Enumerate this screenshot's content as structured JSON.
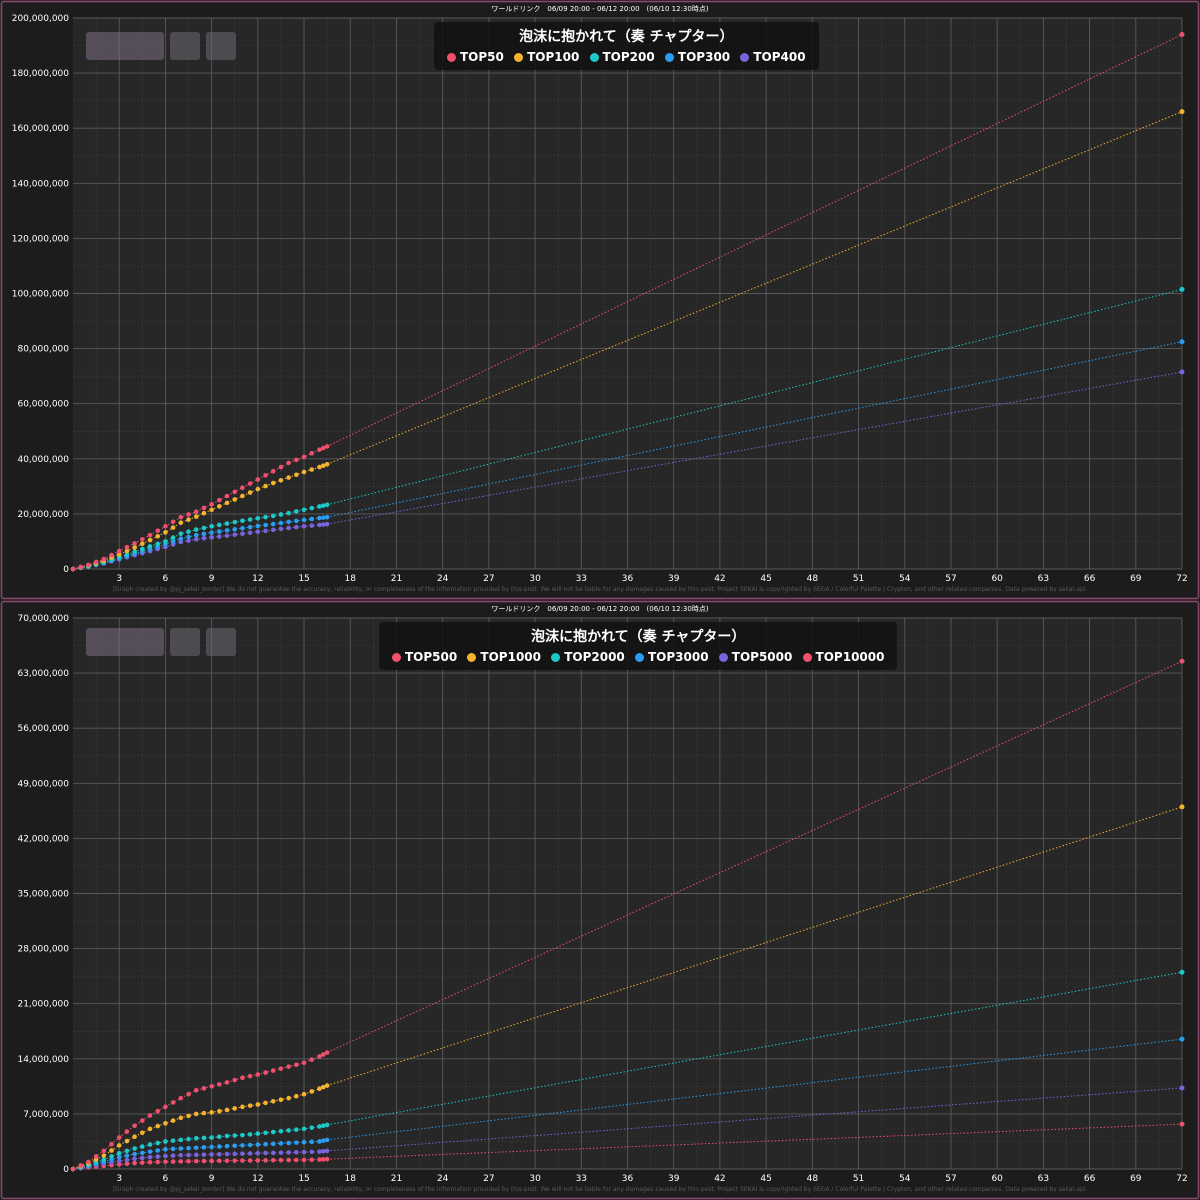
{
  "chart_data": [
    {
      "type": "line",
      "header": "ワールドリンク　06/09 20:00 - 06/12 20:00　(06/10 12:30時点)",
      "title": "泡沫に抱かれて（奏 チャプター）",
      "xlim": [
        0,
        72
      ],
      "x_ticks": [
        3,
        6,
        9,
        12,
        15,
        18,
        21,
        24,
        27,
        30,
        33,
        36,
        39,
        42,
        45,
        48,
        51,
        54,
        57,
        60,
        63,
        66,
        69,
        72
      ],
      "ylim": [
        0,
        200000000
      ],
      "y_ticks": [
        "0",
        "20,000,000",
        "40,000,000",
        "60,000,000",
        "80,000,000",
        "100,000,000",
        "120,000,000",
        "140,000,000",
        "160,000,000",
        "180,000,000",
        "200,000,000"
      ],
      "grid": true,
      "legend": "top-center",
      "credit": "[Graph created by @pj_sekai_border]  We do not guarantee the accuracy, reliability, or completeness of the information provided by this post. We will not be liable for any damages caused by this post. Project SEKAI is copyrighted by SEGA / Colorful Palette / Crypton, and other related companies. Data powered by sekai-api.",
      "series": [
        {
          "name": "TOP50",
          "color": "#f0506e",
          "points": [
            [
              0,
              0
            ],
            [
              1,
              1500000
            ],
            [
              2,
              3600000
            ],
            [
              3,
              6500000
            ],
            [
              4,
              9300000
            ],
            [
              5,
              12300000
            ],
            [
              6,
              15500000
            ],
            [
              7,
              18800000
            ],
            [
              8,
              20800000
            ],
            [
              9,
              23500000
            ],
            [
              10,
              26500000
            ],
            [
              11,
              29500000
            ],
            [
              12,
              32500000
            ],
            [
              13,
              35500000
            ],
            [
              14,
              38500000
            ],
            [
              15,
              40700000
            ],
            [
              16,
              43300000
            ],
            [
              16.5,
              44500000
            ]
          ],
          "projection": [
            72,
            194000000
          ]
        },
        {
          "name": "TOP100",
          "color": "#f5b32f",
          "points": [
            [
              0,
              0
            ],
            [
              1,
              1300000
            ],
            [
              2,
              3000000
            ],
            [
              3,
              5300000
            ],
            [
              4,
              7800000
            ],
            [
              5,
              10500000
            ],
            [
              6,
              13300000
            ],
            [
              7,
              16800000
            ],
            [
              8,
              19000000
            ],
            [
              9,
              21500000
            ],
            [
              10,
              24000000
            ],
            [
              11,
              26500000
            ],
            [
              12,
              29000000
            ],
            [
              13,
              31200000
            ],
            [
              14,
              33200000
            ],
            [
              15,
              35200000
            ],
            [
              16,
              37000000
            ],
            [
              16.5,
              38000000
            ]
          ],
          "projection": [
            72,
            166000000
          ]
        },
        {
          "name": "TOP200",
          "color": "#1fc8c8",
          "points": [
            [
              0,
              0
            ],
            [
              1,
              1000000
            ],
            [
              2,
              2500000
            ],
            [
              3,
              4300000
            ],
            [
              4,
              6300000
            ],
            [
              5,
              8200000
            ],
            [
              6,
              10000000
            ],
            [
              7,
              12800000
            ],
            [
              8,
              14300000
            ],
            [
              9,
              15500000
            ],
            [
              10,
              16500000
            ],
            [
              11,
              17500000
            ],
            [
              12,
              18400000
            ],
            [
              13,
              19300000
            ],
            [
              14,
              20300000
            ],
            [
              15,
              21500000
            ],
            [
              16,
              22700000
            ],
            [
              16.5,
              23300000
            ]
          ],
          "projection": [
            72,
            101500000
          ]
        },
        {
          "name": "TOP300",
          "color": "#2b9df0",
          "points": [
            [
              0,
              0
            ],
            [
              1,
              900000
            ],
            [
              2,
              2200000
            ],
            [
              3,
              3800000
            ],
            [
              4,
              5500000
            ],
            [
              5,
              7200000
            ],
            [
              6,
              9000000
            ],
            [
              7,
              11000000
            ],
            [
              8,
              12300000
            ],
            [
              9,
              13200000
            ],
            [
              10,
              14000000
            ],
            [
              11,
              14800000
            ],
            [
              12,
              15600000
            ],
            [
              13,
              16300000
            ],
            [
              14,
              17100000
            ],
            [
              15,
              17800000
            ],
            [
              16,
              18500000
            ],
            [
              16.5,
              18800000
            ]
          ],
          "projection": [
            72,
            82500000
          ]
        },
        {
          "name": "TOP400",
          "color": "#7b63dc",
          "points": [
            [
              0,
              0
            ],
            [
              1,
              800000
            ],
            [
              2,
              2000000
            ],
            [
              3,
              3500000
            ],
            [
              4,
              5000000
            ],
            [
              5,
              6500000
            ],
            [
              6,
              8000000
            ],
            [
              7,
              9800000
            ],
            [
              8,
              10800000
            ],
            [
              9,
              11500000
            ],
            [
              10,
              12100000
            ],
            [
              11,
              12800000
            ],
            [
              12,
              13500000
            ],
            [
              13,
              14200000
            ],
            [
              14,
              14900000
            ],
            [
              15,
              15500000
            ],
            [
              16,
              16000000
            ],
            [
              16.5,
              16300000
            ]
          ],
          "projection": [
            72,
            71500000
          ]
        }
      ]
    },
    {
      "type": "line",
      "header": "ワールドリンク　06/09 20:00 - 06/12 20:00　(06/10 12:30時点)",
      "title": "泡沫に抱かれて（奏 チャプター）",
      "xlim": [
        0,
        72
      ],
      "x_ticks": [
        3,
        6,
        9,
        12,
        15,
        18,
        21,
        24,
        27,
        30,
        33,
        36,
        39,
        42,
        45,
        48,
        51,
        54,
        57,
        60,
        63,
        66,
        69,
        72
      ],
      "ylim": [
        0,
        70000000
      ],
      "y_ticks": [
        "0",
        "7,000,000",
        "14,000,000",
        "21,000,000",
        "28,000,000",
        "35,000,000",
        "42,000,000",
        "49,000,000",
        "56,000,000",
        "63,000,000",
        "70,000,000"
      ],
      "grid": true,
      "legend": "top-center",
      "credit": "[Graph created by @pj_sekai_border]  We do not guarantee the accuracy, reliability, or completeness of the information provided by this post. We will not be liable for any damages caused by this post. Project SEKAI is copyrighted by SEGA / Colorful Palette / Crypton, and other related companies. Data powered by sekai-api.",
      "series": [
        {
          "name": "TOP500",
          "color": "#f0506e",
          "points": [
            [
              0,
              0
            ],
            [
              1,
              900000
            ],
            [
              2,
              2300000
            ],
            [
              3,
              4000000
            ],
            [
              4,
              5500000
            ],
            [
              5,
              6800000
            ],
            [
              6,
              7900000
            ],
            [
              7,
              9000000
            ],
            [
              8,
              10000000
            ],
            [
              9,
              10500000
            ],
            [
              10,
              11000000
            ],
            [
              11,
              11600000
            ],
            [
              12,
              12000000
            ],
            [
              13,
              12500000
            ],
            [
              14,
              13000000
            ],
            [
              15,
              13500000
            ],
            [
              16,
              14300000
            ],
            [
              16.5,
              14800000
            ]
          ],
          "projection": [
            72,
            64500000
          ]
        },
        {
          "name": "TOP1000",
          "color": "#f5b32f",
          "points": [
            [
              0,
              0
            ],
            [
              1,
              700000
            ],
            [
              2,
              1700000
            ],
            [
              3,
              3000000
            ],
            [
              4,
              4100000
            ],
            [
              5,
              5100000
            ],
            [
              6,
              5800000
            ],
            [
              7,
              6500000
            ],
            [
              8,
              7000000
            ],
            [
              9,
              7200000
            ],
            [
              10,
              7500000
            ],
            [
              11,
              7900000
            ],
            [
              12,
              8200000
            ],
            [
              13,
              8600000
            ],
            [
              14,
              9000000
            ],
            [
              15,
              9500000
            ],
            [
              16,
              10200000
            ],
            [
              16.5,
              10600000
            ]
          ],
          "projection": [
            72,
            46000000
          ]
        },
        {
          "name": "TOP2000",
          "color": "#1fc8c8",
          "points": [
            [
              0,
              0
            ],
            [
              1,
              500000
            ],
            [
              2,
              1200000
            ],
            [
              3,
              2000000
            ],
            [
              4,
              2600000
            ],
            [
              5,
              3100000
            ],
            [
              6,
              3500000
            ],
            [
              7,
              3700000
            ],
            [
              8,
              3900000
            ],
            [
              9,
              4000000
            ],
            [
              10,
              4200000
            ],
            [
              11,
              4300000
            ],
            [
              12,
              4500000
            ],
            [
              13,
              4700000
            ],
            [
              14,
              4900000
            ],
            [
              15,
              5100000
            ],
            [
              16,
              5400000
            ],
            [
              16.5,
              5600000
            ]
          ],
          "projection": [
            72,
            25000000
          ]
        },
        {
          "name": "TOP3000",
          "color": "#2b9df0",
          "points": [
            [
              0,
              0
            ],
            [
              1,
              400000
            ],
            [
              2,
              900000
            ],
            [
              3,
              1500000
            ],
            [
              4,
              1900000
            ],
            [
              5,
              2200000
            ],
            [
              6,
              2500000
            ],
            [
              7,
              2600000
            ],
            [
              8,
              2700000
            ],
            [
              9,
              2800000
            ],
            [
              10,
              2900000
            ],
            [
              11,
              3000000
            ],
            [
              12,
              3100000
            ],
            [
              13,
              3200000
            ],
            [
              14,
              3300000
            ],
            [
              15,
              3400000
            ],
            [
              16,
              3500000
            ],
            [
              16.5,
              3700000
            ]
          ],
          "projection": [
            72,
            16500000
          ]
        },
        {
          "name": "TOP5000",
          "color": "#7b63dc",
          "points": [
            [
              0,
              0
            ],
            [
              1,
              300000
            ],
            [
              2,
              700000
            ],
            [
              3,
              1000000
            ],
            [
              4,
              1300000
            ],
            [
              5,
              1500000
            ],
            [
              6,
              1650000
            ],
            [
              7,
              1750000
            ],
            [
              8,
              1800000
            ],
            [
              9,
              1850000
            ],
            [
              10,
              1900000
            ],
            [
              11,
              1950000
            ],
            [
              12,
              2000000
            ],
            [
              13,
              2050000
            ],
            [
              14,
              2100000
            ],
            [
              15,
              2150000
            ],
            [
              16,
              2200000
            ],
            [
              16.5,
              2300000
            ]
          ],
          "projection": [
            72,
            10300000
          ]
        },
        {
          "name": "TOP10000",
          "color": "#f0506e",
          "points": [
            [
              0,
              0
            ],
            [
              1,
              200000
            ],
            [
              2,
              400000
            ],
            [
              3,
              600000
            ],
            [
              4,
              750000
            ],
            [
              5,
              850000
            ],
            [
              6,
              920000
            ],
            [
              7,
              970000
            ],
            [
              8,
              1000000
            ],
            [
              9,
              1020000
            ],
            [
              10,
              1050000
            ],
            [
              11,
              1070000
            ],
            [
              12,
              1090000
            ],
            [
              13,
              1110000
            ],
            [
              14,
              1130000
            ],
            [
              15,
              1150000
            ],
            [
              16,
              1200000
            ],
            [
              16.5,
              1250000
            ]
          ],
          "projection": [
            72,
            5700000
          ]
        }
      ]
    }
  ]
}
